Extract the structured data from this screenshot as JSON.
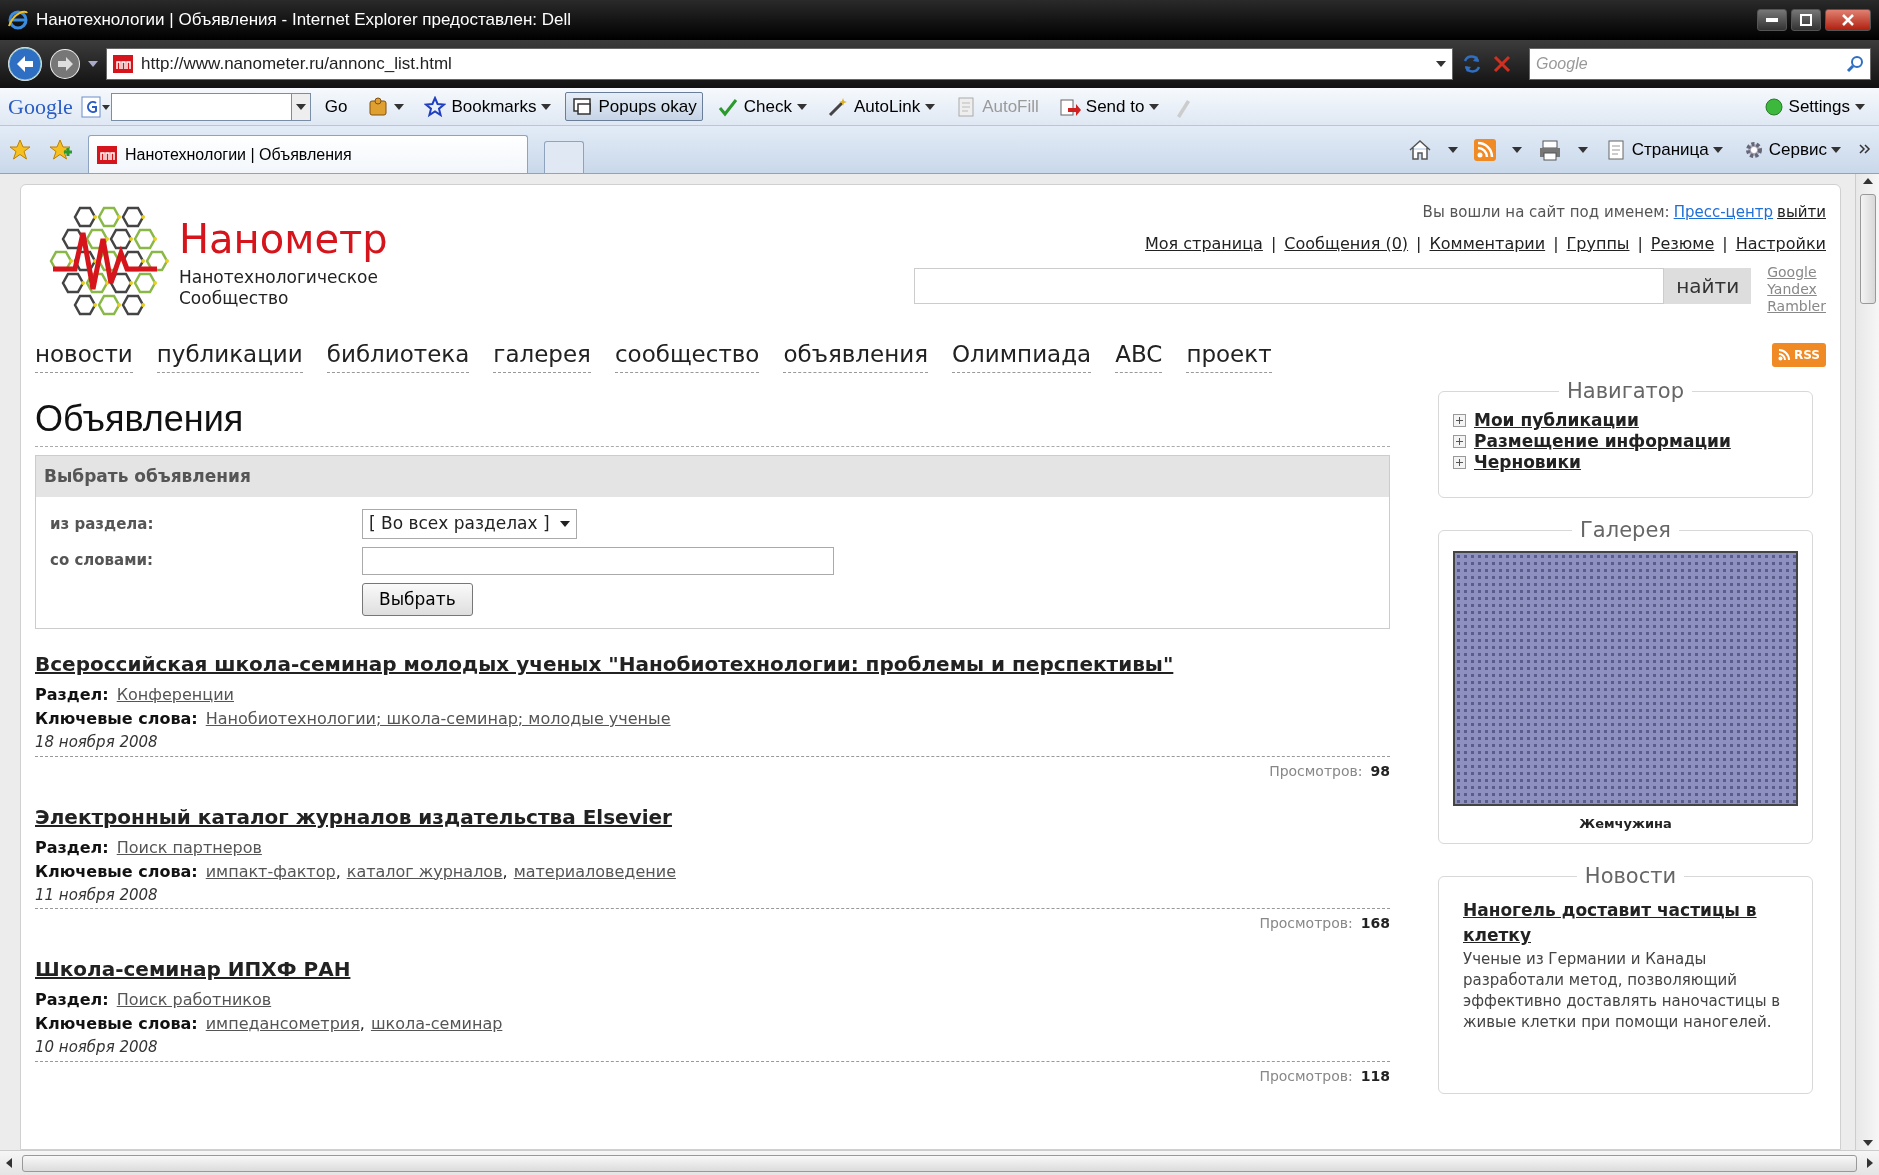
{
  "window": {
    "title": "Нанотехнологии | Объявления - Internet Explorer предоставлен: Dell"
  },
  "address_bar": {
    "url": "http://www.nanometer.ru/annonc_list.html"
  },
  "search_box": {
    "placeholder": "Google"
  },
  "google_toolbar": {
    "brand": "Google",
    "go": "Go",
    "items": [
      {
        "label": "Bookmarks",
        "menu": true,
        "pressed": false,
        "disabled": false
      },
      {
        "label": "Popups okay",
        "menu": false,
        "pressed": true,
        "disabled": false
      },
      {
        "label": "Check",
        "menu": true,
        "pressed": false,
        "disabled": false
      },
      {
        "label": "AutoLink",
        "menu": true,
        "pressed": false,
        "disabled": false
      },
      {
        "label": "AutoFill",
        "menu": false,
        "pressed": false,
        "disabled": true
      },
      {
        "label": "Send to",
        "menu": true,
        "pressed": false,
        "disabled": false
      }
    ],
    "settings": "Settings"
  },
  "tabs": [
    {
      "label": "Нанотехнологии | Объявления",
      "selected": true
    }
  ],
  "command_bar": [
    {
      "label": "Страница"
    },
    {
      "label": "Сервис"
    }
  ],
  "site": {
    "logo_name": "Нанометр",
    "logo_tagline": "Нанотехнологическое Сообщество",
    "login": {
      "prefix": "Вы вошли на сайт под именем:",
      "user": "Пресс-центр",
      "logout": "выйти"
    },
    "separator": "|",
    "user_links": [
      "Моя страница",
      "Сообщения (0)",
      "Комментарии",
      "Группы",
      "Резюме",
      "Настройки"
    ],
    "search": {
      "button": "найти",
      "engines": [
        "Google",
        "Yandex",
        "Rambler"
      ]
    },
    "nav": [
      "новости",
      "публикации",
      "библиотека",
      "галерея",
      "сообщество",
      "объявления",
      "Олимпиада",
      "ABC",
      "проект"
    ],
    "rss": "RSS"
  },
  "page_title": "Объявления",
  "filter": {
    "title": "Выбрать объявления",
    "fields": [
      {
        "label": "из раздела:",
        "kind": "select",
        "value": "[ Во всех разделах ]"
      },
      {
        "label": "со словами:",
        "kind": "text"
      }
    ],
    "button": "Выбрать"
  },
  "keyword_separator": ",",
  "announcements": [
    {
      "title": "Всероссийская школа-семинар молодых ученых \"Нанобиотехнологии: проблемы и перспективы\"",
      "section_label": "Раздел:",
      "section": "Конференции",
      "keywords_label": "Ключевые слова:",
      "keywords": [
        "Нанобиотехнологии; школа-семинар; молодые ученые"
      ],
      "date": "18 ноября 2008",
      "views_label": "Просмотров:",
      "views": "98"
    },
    {
      "title": "Электронный каталог журналов издательства Elsevier",
      "section_label": "Раздел:",
      "section": "Поиск партнеров",
      "keywords_label": "Ключевые слова:",
      "keywords": [
        "импакт-фактор",
        "каталог журналов",
        "материаловедение"
      ],
      "date": "11 ноября 2008",
      "views_label": "Просмотров:",
      "views": "168"
    },
    {
      "title": "Школа-семинар ИПХФ РАН",
      "section_label": "Раздел:",
      "section": "Поиск работников",
      "keywords_label": "Ключевые слова:",
      "keywords": [
        "импедансометрия",
        "школа-семинар"
      ],
      "date": "10 ноября 2008",
      "views_label": "Просмотров:",
      "views": "118"
    }
  ],
  "sidebar": {
    "navigator": {
      "title": "Навигатор",
      "items": [
        {
          "label": "Мои публикации",
          "expanded": false
        },
        {
          "label": "Размещение информации",
          "expanded": false
        },
        {
          "label": "Черновики",
          "expanded": false
        }
      ]
    },
    "gallery": {
      "title": "Галерея",
      "caption": "Жемчужина"
    },
    "news": {
      "title": "Новости",
      "items": [
        {
          "title": "Наногель доставит частицы в клетку",
          "text": "Ученые из Германии и Канады разработали метод, позволяющий эффективно доставлять наночастицы в живые клетки при помощи наногелей."
        }
      ]
    }
  }
}
